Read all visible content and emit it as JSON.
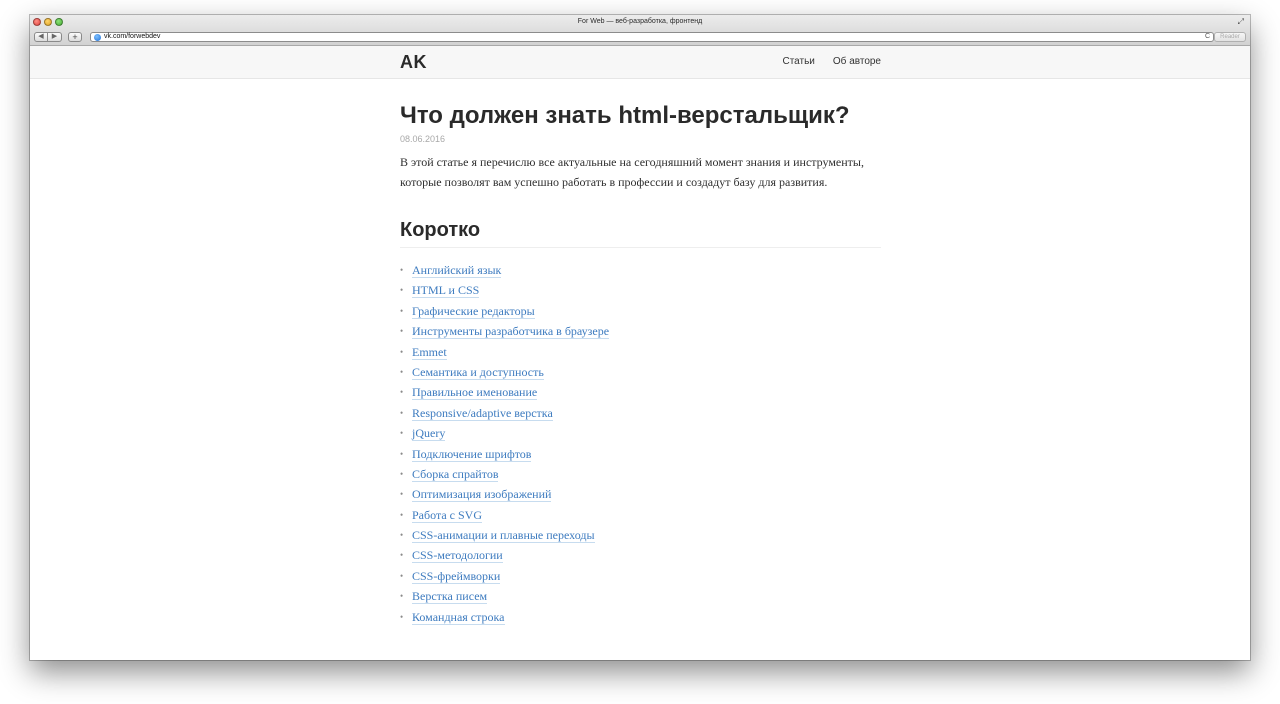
{
  "browser": {
    "window_title": "For Web — веб-разработка, фронтенд",
    "url": "vk.com/forwebdev",
    "reader_label": "Reader",
    "back_glyph": "◀",
    "forward_glyph": "▶",
    "add_glyph": "+",
    "reload_glyph": "C",
    "fullscreen_glyph": "⤢"
  },
  "site": {
    "logo": "AK",
    "nav": [
      "Статьи",
      "Об авторе"
    ]
  },
  "article": {
    "title": "Что должен знать html-верстальщик?",
    "date": "08.06.2016",
    "intro": "В этой статье я перечислю все актуальные на сегодняшний момент знания и инструменты, которые позволят вам успешно работать в профессии и создадут базу для развития.",
    "section_title": "Коротко",
    "items": [
      "Английский язык",
      "HTML и CSS",
      "Графические редакторы",
      "Инструменты разработчика в браузере",
      "Emmet",
      "Семантика и доступность",
      "Правильное именование",
      "Responsive/adaptive верстка",
      "jQuery",
      "Подключение шрифтов",
      "Сборка спрайтов",
      "Оптимизация изображений",
      "Работа с SVG",
      "CSS-анимации и плавные переходы",
      "CSS-методологии",
      "CSS-фреймворки",
      "Верстка писем",
      "Командная строка"
    ]
  },
  "colors": {
    "link": "#3d7bbf",
    "link_underline": "#c7dcef",
    "header_bg": "#f7f7f7",
    "date": "#a8a8a8"
  }
}
